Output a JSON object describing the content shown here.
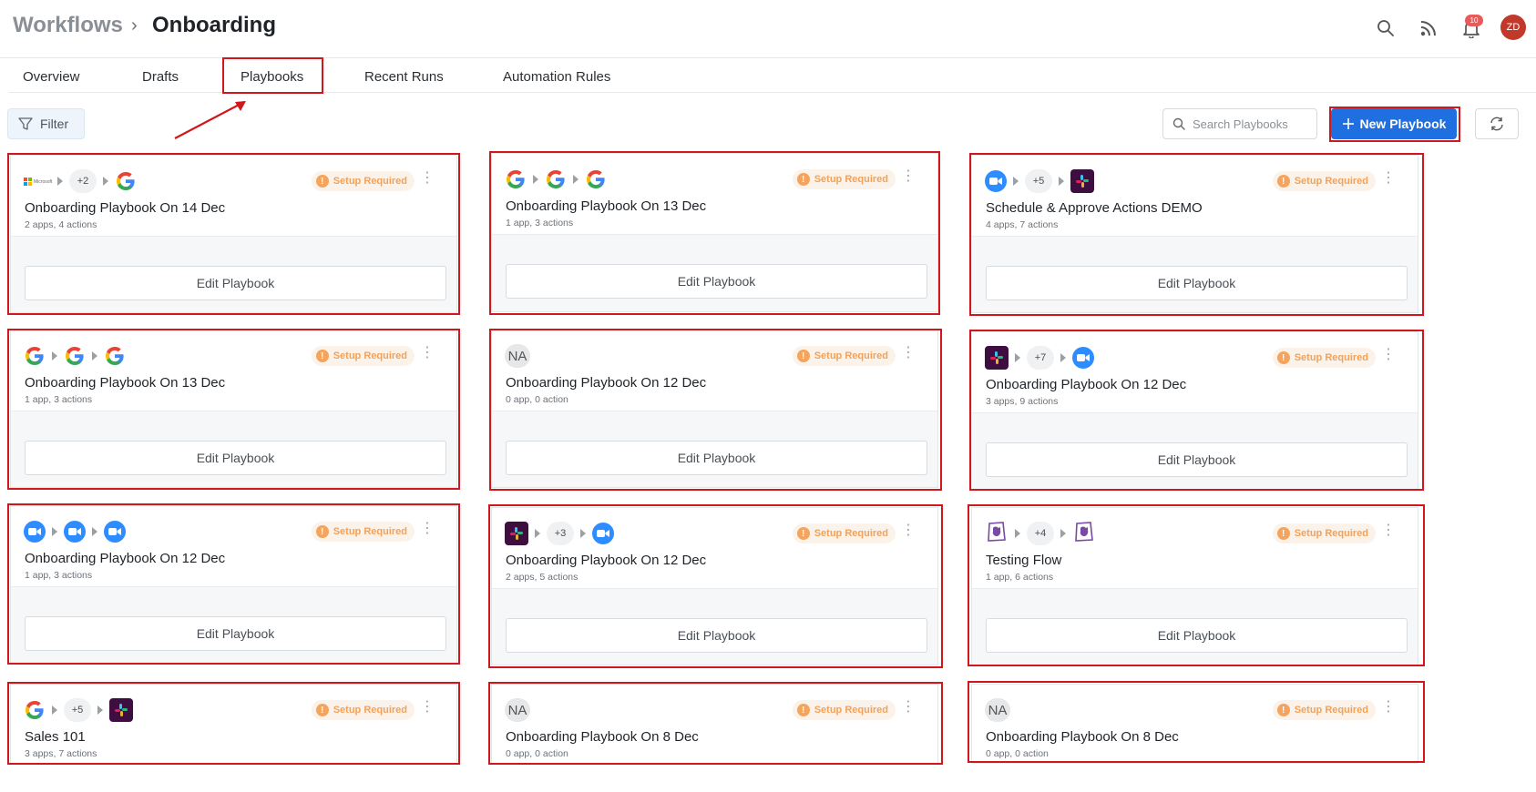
{
  "header": {
    "breadcrumb_root": "Workflows",
    "breadcrumb_separator": "›",
    "breadcrumb_current": "Onboarding",
    "notification_count": "10",
    "avatar_initials": "ZD"
  },
  "tabs": [
    {
      "label": "Overview",
      "active": false
    },
    {
      "label": "Drafts",
      "active": false
    },
    {
      "label": "Playbooks",
      "active": true
    },
    {
      "label": "Recent Runs",
      "active": false
    },
    {
      "label": "Automation Rules",
      "active": false
    }
  ],
  "toolbar": {
    "filter_label": "Filter",
    "search_placeholder": "Search Playbooks",
    "new_button_label": "New Playbook"
  },
  "status_label": "Setup Required",
  "edit_label": "Edit Playbook",
  "colors": {
    "accent": "#1f6fe0",
    "highlight": "#d0171b",
    "status": "#f2a15a"
  },
  "cards": [
    {
      "title": "Onboarding Playbook On 14 Dec",
      "meta": "2 apps, 4 actions",
      "apps": [
        "microsoft",
        "+2",
        "google"
      ]
    },
    {
      "title": "Onboarding Playbook On 13 Dec",
      "meta": "1 app, 3 actions",
      "apps": [
        "google",
        "google",
        "google"
      ]
    },
    {
      "title": "Schedule & Approve Actions DEMO",
      "meta": "4 apps, 7 actions",
      "apps": [
        "zoom",
        "+5",
        "slack"
      ]
    },
    {
      "title": "Onboarding Playbook On 13 Dec",
      "meta": "1 app, 3 actions",
      "apps": [
        "google",
        "google",
        "google"
      ]
    },
    {
      "title": "Onboarding Playbook On 12 Dec",
      "meta": "0 app, 0 action",
      "apps": [
        "NA"
      ]
    },
    {
      "title": "Onboarding Playbook On 12 Dec",
      "meta": "3 apps, 9 actions",
      "apps": [
        "slack",
        "+7",
        "zoom"
      ]
    },
    {
      "title": "Onboarding Playbook On 12 Dec",
      "meta": "1 app, 3 actions",
      "apps": [
        "zoom",
        "zoom",
        "zoom"
      ]
    },
    {
      "title": "Onboarding Playbook On 12 Dec",
      "meta": "2 apps, 5 actions",
      "apps": [
        "slack",
        "+3",
        "zoom"
      ]
    },
    {
      "title": "Testing Flow",
      "meta": "1 app, 6 actions",
      "apps": [
        "datadog",
        "+4",
        "datadog"
      ]
    },
    {
      "title": "Sales 101",
      "meta": "3 apps, 7 actions",
      "apps": [
        "google",
        "+5",
        "slack"
      ]
    },
    {
      "title": "Onboarding Playbook On 8 Dec",
      "meta": "0 app, 0 action",
      "apps": [
        "NA"
      ]
    },
    {
      "title": "Onboarding Playbook On 8 Dec",
      "meta": "0 app, 0 action",
      "apps": [
        "NA"
      ]
    }
  ]
}
